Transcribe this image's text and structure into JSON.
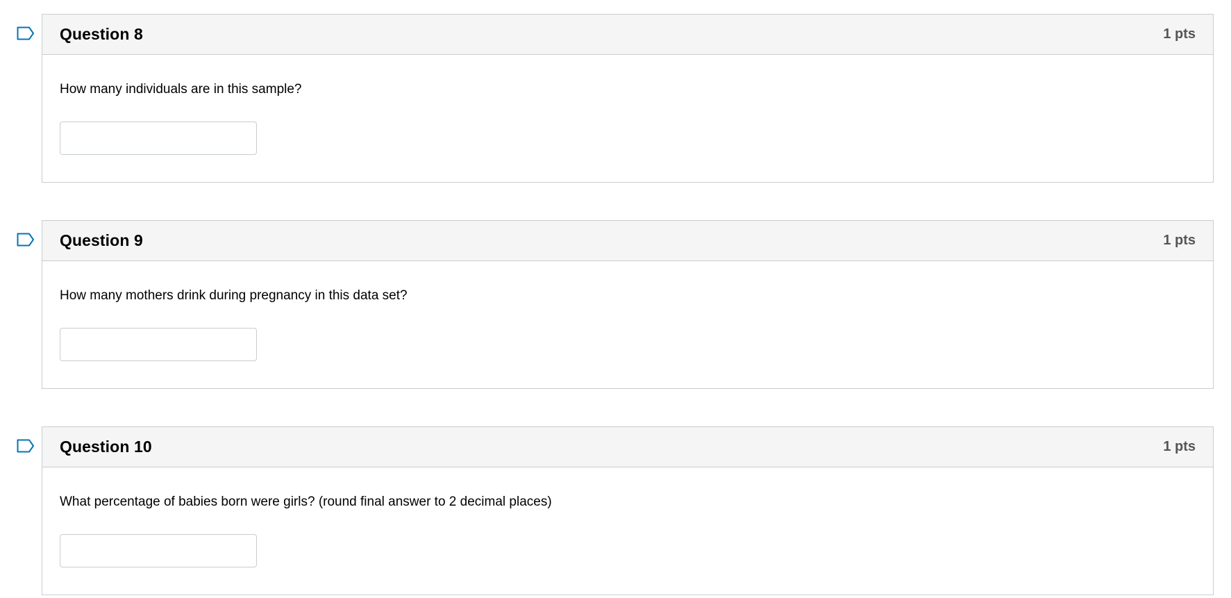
{
  "questions": [
    {
      "title": "Question 8",
      "points": "1 pts",
      "text": "How many individuals are in this sample?",
      "answer": ""
    },
    {
      "title": "Question 9",
      "points": "1 pts",
      "text": "How many mothers drink during pregnancy in this data set?",
      "answer": ""
    },
    {
      "title": "Question 10",
      "points": "1 pts",
      "text": "What percentage of babies born were girls? (round final answer to 2 decimal places)",
      "answer": ""
    }
  ],
  "icons": {
    "flag": "flag-outline-icon"
  },
  "colors": {
    "flag": "#0374b5",
    "header_bg": "#f5f5f5",
    "border": "#c7cdd1"
  }
}
